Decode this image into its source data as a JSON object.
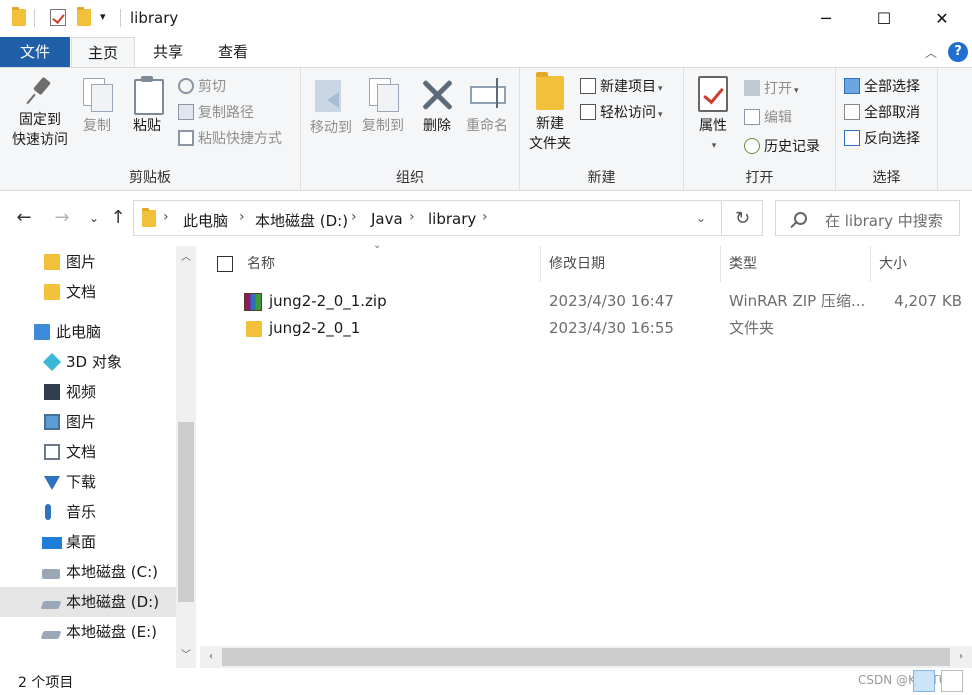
{
  "window": {
    "title": "library",
    "minimize": "─",
    "maximize": "☐",
    "close": "✕"
  },
  "tabs": [
    {
      "label": "文件"
    },
    {
      "label": "主页"
    },
    {
      "label": "共享"
    },
    {
      "label": "查看"
    }
  ],
  "ribbon": {
    "clipboard": {
      "label": "剪贴板",
      "pin": "固定到\n快速访问",
      "pin_l1": "固定到",
      "pin_l2": "快速访问",
      "copy": "复制",
      "paste": "粘贴",
      "cut": "剪切",
      "copy_path": "复制路径",
      "paste_shortcut": "粘贴快捷方式"
    },
    "organize": {
      "label": "组织",
      "move_to": "移动到",
      "copy_to": "复制到",
      "delete": "删除",
      "rename": "重命名"
    },
    "new": {
      "label": "新建",
      "new_folder_l1": "新建",
      "new_folder_l2": "文件夹",
      "new_item": "新建项目",
      "easy_access": "轻松访问"
    },
    "open": {
      "label": "打开",
      "properties": "属性",
      "open": "打开",
      "edit": "编辑",
      "history": "历史记录"
    },
    "select": {
      "label": "选择",
      "select_all": "全部选择",
      "select_none": "全部取消",
      "invert": "反向选择"
    }
  },
  "address": {
    "crumbs": [
      "此电脑",
      "本地磁盘 (D:)",
      "Java",
      "library"
    ],
    "search_placeholder": "在 library 中搜索"
  },
  "nav": {
    "items": [
      {
        "label": "图片",
        "icon": "folder-icon"
      },
      {
        "label": "文档",
        "icon": "folder-icon"
      },
      {
        "label": "此电脑",
        "icon": "computer-icon"
      },
      {
        "label": "3D 对象",
        "icon": "3d-objects-icon"
      },
      {
        "label": "视频",
        "icon": "video-icon"
      },
      {
        "label": "图片",
        "icon": "pictures-icon"
      },
      {
        "label": "文档",
        "icon": "documents-icon"
      },
      {
        "label": "下载",
        "icon": "download-icon"
      },
      {
        "label": "音乐",
        "icon": "music-icon"
      },
      {
        "label": "桌面",
        "icon": "desktop-icon"
      },
      {
        "label": "本地磁盘 (C:)",
        "icon": "drive-c-icon"
      },
      {
        "label": "本地磁盘 (D:)",
        "icon": "drive-icon",
        "selected": true
      },
      {
        "label": "本地磁盘 (E:)",
        "icon": "drive-icon"
      }
    ]
  },
  "files": {
    "columns": [
      "名称",
      "修改日期",
      "类型",
      "大小"
    ],
    "rows": [
      {
        "name": "jung2-2_0_1.zip",
        "modified": "2023/4/30 16:47",
        "type": "WinRAR ZIP 压缩...",
        "size": "4,207 KB",
        "icon": "zip-archive-icon"
      },
      {
        "name": "jung2-2_0_1",
        "modified": "2023/4/30 16:55",
        "type": "文件夹",
        "size": "",
        "icon": "folder-icon"
      }
    ]
  },
  "status": {
    "count": "2 个项目",
    "watermark": "CSDN @KIRITUI..."
  }
}
